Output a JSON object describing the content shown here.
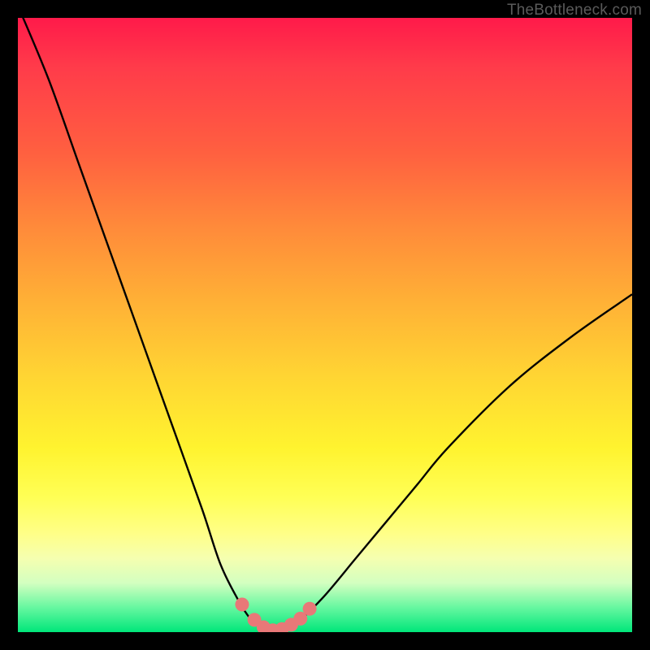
{
  "watermark": "TheBottleneck.com",
  "colors": {
    "background": "#000000",
    "curve_stroke": "#000000",
    "marker_fill": "#e87878",
    "gradient_stops": [
      "#ff1a4a",
      "#ff6040",
      "#ffb036",
      "#fff32f",
      "#ffff88",
      "#66f7a0",
      "#00e67a"
    ]
  },
  "chart_data": {
    "type": "line",
    "title": "",
    "xlabel": "",
    "ylabel": "",
    "xlim": [
      0,
      100
    ],
    "ylim": [
      0,
      100
    ],
    "series": [
      {
        "name": "bottleneck-curve",
        "x": [
          0,
          5,
          10,
          15,
          20,
          25,
          30,
          33,
          36,
          38,
          40,
          42,
          44,
          46,
          50,
          55,
          60,
          65,
          70,
          80,
          90,
          100
        ],
        "y": [
          102,
          90,
          76,
          62,
          48,
          34,
          20,
          11,
          5,
          2,
          0.5,
          0,
          0.5,
          2,
          6,
          12,
          18,
          24,
          30,
          40,
          48,
          55
        ]
      }
    ],
    "markers": {
      "name": "trough-points",
      "x": [
        36.5,
        38.5,
        40,
        41.5,
        43,
        44.5,
        46,
        47.5
      ],
      "y": [
        4.5,
        2,
        0.8,
        0.3,
        0.5,
        1.2,
        2.2,
        3.8
      ]
    }
  }
}
